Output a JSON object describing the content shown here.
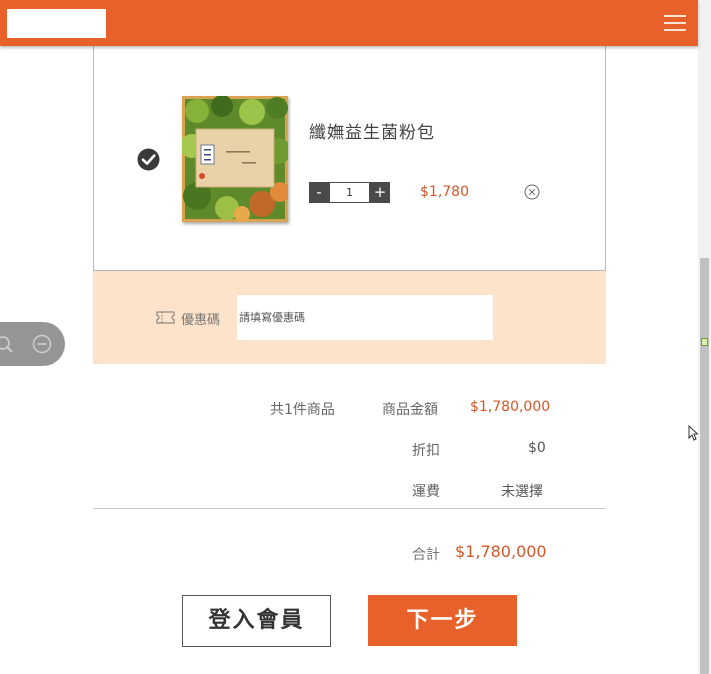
{
  "header": {
    "menu_icon": "hamburger-menu-icon",
    "brand_color": "#e8602a"
  },
  "cart_item": {
    "selected": true,
    "name": "纖嫵益生菌粉包",
    "quantity": "1",
    "minus_label": "-",
    "plus_label": "+",
    "price": "$1,780",
    "image_icon": "product-package-image",
    "remove_icon": "circle-x-icon"
  },
  "coupon": {
    "label": "優惠碼",
    "placeholder": "請填寫優惠碼",
    "icon": "ticket-icon",
    "panel_color": "#fde3c9"
  },
  "summary": {
    "item_count": "共1件商品",
    "subtotal_label": "商品金額",
    "subtotal_value": "$1,780,000",
    "discount_label": "折扣",
    "discount_value": "$0",
    "shipping_label": "運費",
    "shipping_value": "未選擇",
    "total_label": "合計",
    "total_value": "$1,780,000"
  },
  "actions": {
    "login_label": "登入會員",
    "next_label": "下一步"
  },
  "zoom_widget": {
    "zoom_in_icon": "zoom-in-icon",
    "zoom_out_icon": "zoom-out-icon"
  },
  "colors": {
    "accent": "#e8602a",
    "price": "#d4572a"
  }
}
